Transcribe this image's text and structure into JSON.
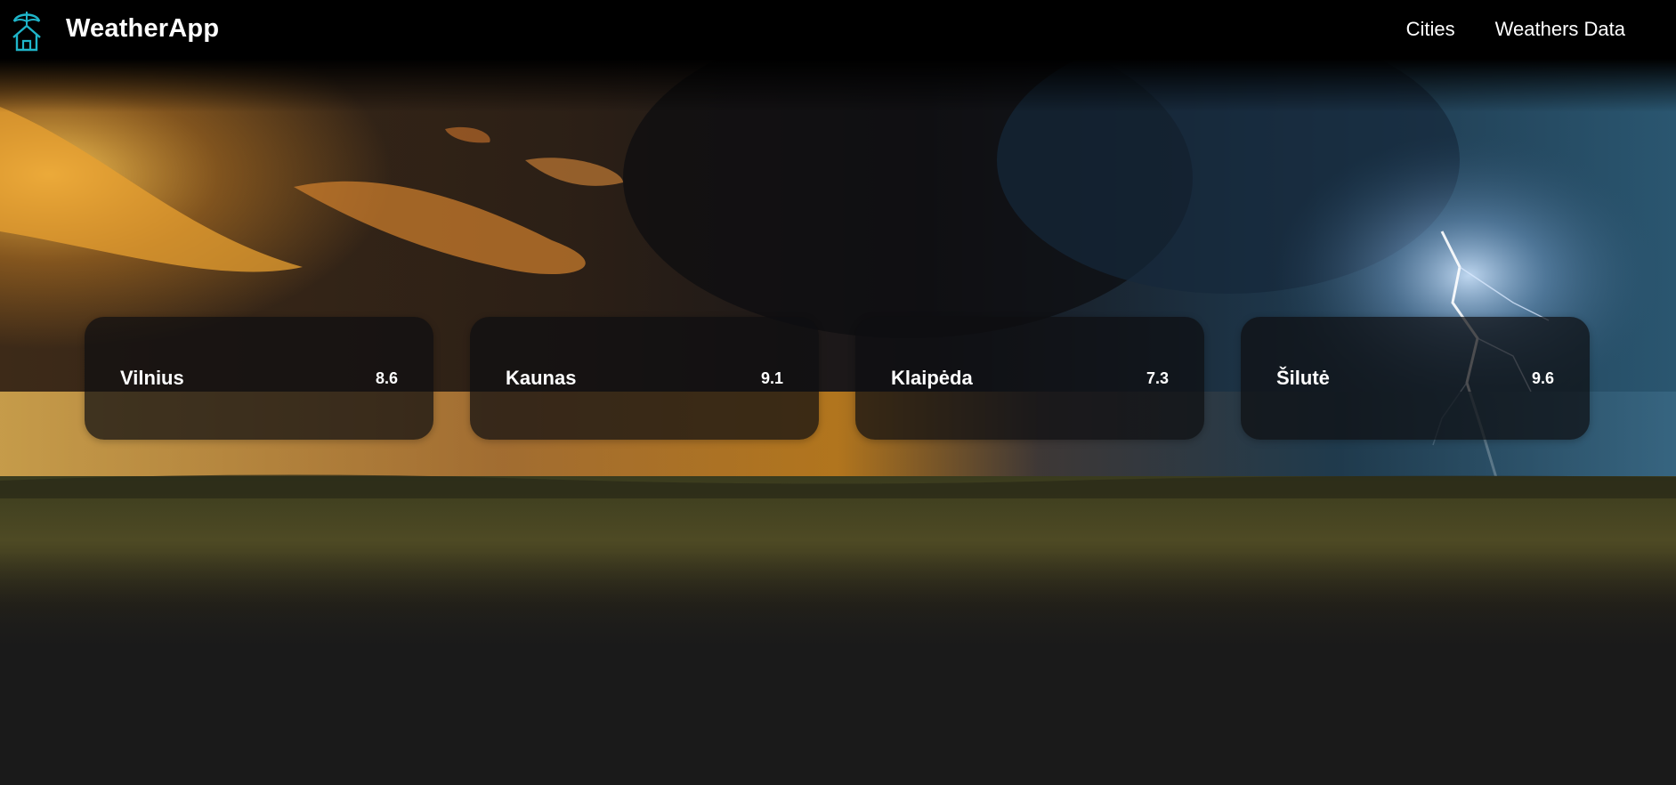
{
  "header": {
    "brand": "WeatherApp",
    "logo_icon": "umbrella-house-icon",
    "nav": [
      {
        "label": "Cities"
      },
      {
        "label": "Weathers Data"
      }
    ]
  },
  "hero": {
    "background": "storm-over-grassland-photo"
  },
  "cities": [
    {
      "name": "Vilnius",
      "value": "8.6"
    },
    {
      "name": "Kaunas",
      "value": "9.1"
    },
    {
      "name": "Klaipėda",
      "value": "7.3"
    },
    {
      "name": "Šilutė",
      "value": "9.6"
    }
  ],
  "colors": {
    "navbar": "#000000",
    "page_background": "#1a1a1a",
    "logo_accent": "#1fb5c9",
    "text": "#ffffff"
  }
}
